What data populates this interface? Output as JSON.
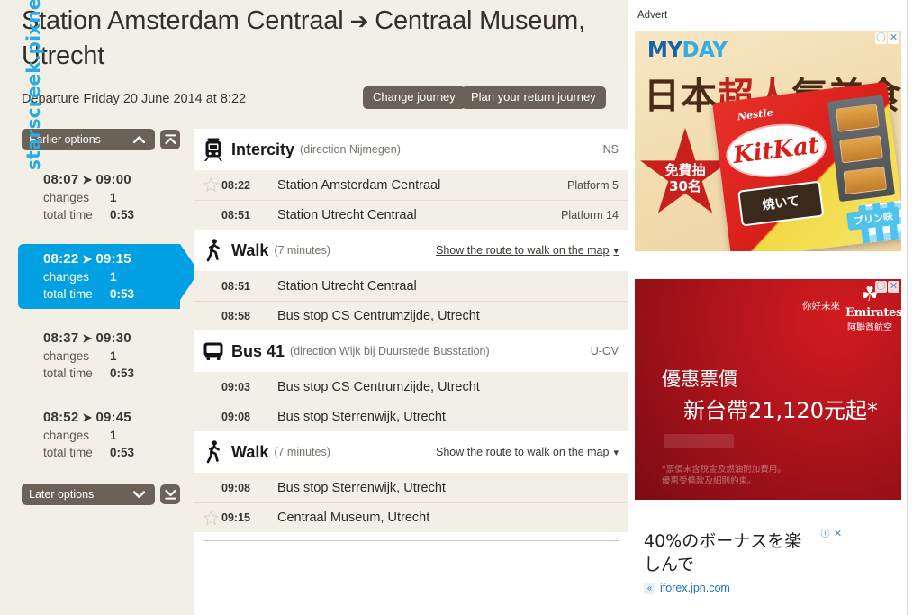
{
  "watermark": "starscreek.pixnet.net",
  "header": {
    "origin": "Station Amsterdam Centraal",
    "arrow": "➔",
    "destination": "Centraal Museum, Utrecht",
    "departure_text": "Departure Friday 20 June 2014 at 8:22",
    "change_journey_label": "Change journey",
    "return_journey_label": "Plan your return journey"
  },
  "options": {
    "earlier_label": "Earlier options",
    "later_label": "Later options",
    "changes_label": "changes",
    "total_time_label": "total time",
    "list": [
      {
        "depart": "08:07",
        "arrive": "09:00",
        "changes": "1",
        "total_time": "0:53",
        "selected": false
      },
      {
        "depart": "08:22",
        "arrive": "09:15",
        "changes": "1",
        "total_time": "0:53",
        "selected": true
      },
      {
        "depart": "08:37",
        "arrive": "09:30",
        "changes": "1",
        "total_time": "0:53",
        "selected": false
      },
      {
        "depart": "08:52",
        "arrive": "09:45",
        "changes": "1",
        "total_time": "0:53",
        "selected": false
      }
    ]
  },
  "legs": [
    {
      "icon": "train-icon",
      "title": "Intercity",
      "subtitle": "(direction Nijmegen)",
      "operator": "NS",
      "stops": [
        {
          "star": true,
          "time": "08:22",
          "name": "Station Amsterdam Centraal",
          "platform": "Platform 5"
        },
        {
          "star": false,
          "time": "08:51",
          "name": "Station Utrecht Centraal",
          "platform": "Platform 14"
        }
      ]
    },
    {
      "icon": "walk-icon",
      "title": "Walk",
      "subtitle": "(7 minutes)",
      "map_link": "Show the route to walk on the map",
      "stops": [
        {
          "star": false,
          "time": "08:51",
          "name": "Station Utrecht Centraal",
          "platform": ""
        },
        {
          "star": false,
          "time": "08:58",
          "name": "Bus stop CS Centrumzijde, Utrecht",
          "platform": ""
        }
      ]
    },
    {
      "icon": "bus-icon",
      "title": "Bus 41",
      "subtitle": "(direction Wijk bij Duurstede Busstation)",
      "operator": "U-OV",
      "stops": [
        {
          "star": false,
          "time": "09:03",
          "name": "Bus stop CS Centrumzijde, Utrecht",
          "platform": ""
        },
        {
          "star": false,
          "time": "09:08",
          "name": "Bus stop Sterrenwijk, Utrecht",
          "platform": ""
        }
      ]
    },
    {
      "icon": "walk-icon",
      "title": "Walk",
      "subtitle": "(7 minutes)",
      "map_link": "Show the route to walk on the map",
      "stops": [
        {
          "star": false,
          "time": "09:08",
          "name": "Bus stop Sterrenwijk, Utrecht",
          "platform": ""
        },
        {
          "star": true,
          "time": "09:15",
          "name": "Centraal Museum, Utrecht",
          "platform": ""
        }
      ]
    }
  ],
  "ads": {
    "label": "Advert",
    "ad1": {
      "brand": "MYDAY",
      "brand_part1": "MY",
      "brand_part2": "DAY",
      "headline_1": "日本",
      "headline_2": "超人",
      "headline_3": "氣美食",
      "star_line1": "免費抽",
      "star_line2": "30名",
      "product": "KitKat",
      "nestle": "Nestle",
      "plate": "焼いて",
      "flavour": "プリン味"
    },
    "ad2": {
      "logo_en": "Emirates",
      "logo_cn": "阿聯酋航空",
      "tagline": "你好未來",
      "headline_1": "優惠票價",
      "headline_2": "新台帶21,120元起*",
      "fine_print_1": "*票價未含稅金及燃油附加費用。",
      "fine_print_2": "優惠受條款及細則約束。"
    },
    "ad3": {
      "line1": "40%のボーナスを楽",
      "line2": "しんで",
      "url": "iforex.jpn.com"
    },
    "badge_info": "ⓘ",
    "badge_close": "✕"
  }
}
